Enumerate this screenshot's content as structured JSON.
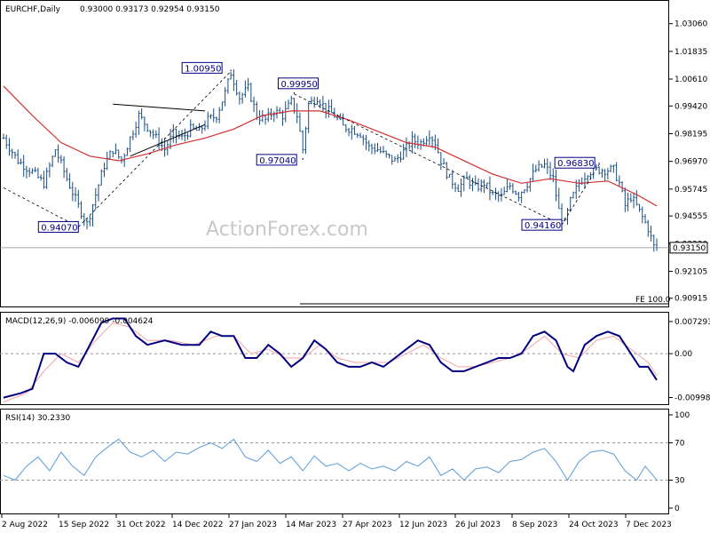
{
  "chart_data": {
    "type": "candlestick",
    "symbol": "EURCHF,Daily",
    "ohlc_text": "0.93000 0.93173 0.92954 0.93150",
    "watermark": "ActionForex.com",
    "x_ticks": [
      "2 Aug 2022",
      "15 Sep 2022",
      "31 Oct 2022",
      "14 Dec 2022",
      "27 Jan 2023",
      "14 Mar 2023",
      "27 Apr 2023",
      "12 Jun 2023",
      "26 Jul 2023",
      "8 Sep 2023",
      "24 Oct 2023",
      "7 Dec 2023"
    ],
    "price": {
      "y_ticks": [
        "1.03060",
        "1.01835",
        "1.00610",
        "0.99420",
        "0.98195",
        "0.96970",
        "0.95745",
        "0.94555",
        "0.93330",
        "0.92105",
        "0.90915"
      ],
      "ylim": [
        0.9055,
        1.0348
      ],
      "last_value": "0.93150",
      "fe_label": "FE 100.0",
      "close_path": [
        [
          0,
          0.98
        ],
        [
          5,
          0.97
        ],
        [
          10,
          0.965
        ],
        [
          14,
          0.96
        ],
        [
          18,
          0.975
        ],
        [
          22,
          0.962
        ],
        [
          26,
          0.95
        ],
        [
          29,
          0.942
        ],
        [
          32,
          0.955
        ],
        [
          35,
          0.968
        ],
        [
          38,
          0.975
        ],
        [
          41,
          0.97
        ],
        [
          44,
          0.98
        ],
        [
          47,
          0.99
        ],
        [
          50,
          0.985
        ],
        [
          53,
          0.98
        ],
        [
          56,
          0.975
        ],
        [
          59,
          0.982
        ],
        [
          62,
          0.98
        ],
        [
          65,
          0.984
        ],
        [
          68,
          0.983
        ],
        [
          71,
          0.988
        ],
        [
          74,
          0.99
        ],
        [
          77,
          1.0
        ],
        [
          79,
          1.009
        ],
        [
          82,
          0.998
        ],
        [
          85,
          1.002
        ],
        [
          88,
          0.99
        ],
        [
          91,
          0.988
        ],
        [
          94,
          0.992
        ],
        [
          97,
          0.99
        ],
        [
          100,
          0.996
        ],
        [
          102,
          0.99
        ],
        [
          104,
          0.975
        ],
        [
          106,
          0.995
        ],
        [
          109,
          0.998
        ],
        [
          112,
          0.993
        ],
        [
          115,
          0.99
        ],
        [
          118,
          0.985
        ],
        [
          121,
          0.984
        ],
        [
          124,
          0.982
        ],
        [
          127,
          0.976
        ],
        [
          130,
          0.975
        ],
        [
          133,
          0.972
        ],
        [
          136,
          0.97
        ],
        [
          139,
          0.974
        ],
        [
          142,
          0.979
        ],
        [
          145,
          0.978
        ],
        [
          148,
          0.982
        ],
        [
          150,
          0.978
        ],
        [
          152,
          0.97
        ],
        [
          155,
          0.962
        ],
        [
          158,
          0.958
        ],
        [
          161,
          0.962
        ],
        [
          164,
          0.958
        ],
        [
          167,
          0.96
        ],
        [
          170,
          0.955
        ],
        [
          173,
          0.954
        ],
        [
          176,
          0.959
        ],
        [
          179,
          0.955
        ],
        [
          182,
          0.96
        ],
        [
          185,
          0.966
        ],
        [
          188,
          0.968
        ],
        [
          191,
          0.962
        ],
        [
          193,
          0.948
        ],
        [
          195,
          0.942
        ],
        [
          197,
          0.952
        ],
        [
          200,
          0.96
        ],
        [
          203,
          0.965
        ],
        [
          206,
          0.966
        ],
        [
          209,
          0.966
        ],
        [
          212,
          0.966
        ],
        [
          214,
          0.96
        ],
        [
          216,
          0.95
        ],
        [
          218,
          0.954
        ],
        [
          220,
          0.95
        ],
        [
          222,
          0.945
        ],
        [
          224,
          0.94
        ],
        [
          226,
          0.932
        ],
        [
          227,
          0.9315
        ]
      ],
      "ma_path": [
        [
          0,
          1.003
        ],
        [
          10,
          0.99
        ],
        [
          20,
          0.978
        ],
        [
          30,
          0.972
        ],
        [
          40,
          0.97
        ],
        [
          50,
          0.973
        ],
        [
          60,
          0.977
        ],
        [
          70,
          0.98
        ],
        [
          80,
          0.984
        ],
        [
          90,
          0.99
        ],
        [
          100,
          0.992
        ],
        [
          110,
          0.992
        ],
        [
          120,
          0.988
        ],
        [
          130,
          0.983
        ],
        [
          140,
          0.978
        ],
        [
          150,
          0.976
        ],
        [
          160,
          0.97
        ],
        [
          170,
          0.964
        ],
        [
          180,
          0.96
        ],
        [
          190,
          0.962
        ],
        [
          200,
          0.96
        ],
        [
          210,
          0.961
        ],
        [
          220,
          0.955
        ],
        [
          227,
          0.95
        ]
      ],
      "annotations": [
        {
          "text": "1.00950",
          "x": 79,
          "y": 1.0095
        },
        {
          "text": "0.99950",
          "x": 101,
          "y": 0.9995
        },
        {
          "text": "0.97040",
          "x": 104,
          "y": 0.9704
        },
        {
          "text": "0.94070",
          "x": 26,
          "y": 0.9407
        },
        {
          "text": "0.96830",
          "x": 207,
          "y": 0.9683
        },
        {
          "text": "0.94160",
          "x": 194,
          "y": 0.9416
        }
      ]
    },
    "macd": {
      "label": "MACD(12,26,9) -0.006099 -0.004624",
      "y_ticks": [
        "0.007293",
        "0.00",
        "-0.009989"
      ],
      "ylim": [
        -0.0115,
        0.0085
      ],
      "main": [
        [
          0,
          -0.01
        ],
        [
          6,
          -0.009
        ],
        [
          10,
          -0.008
        ],
        [
          14,
          0.0
        ],
        [
          18,
          0.0
        ],
        [
          22,
          -0.002
        ],
        [
          26,
          -0.003
        ],
        [
          30,
          0.002
        ],
        [
          34,
          0.007
        ],
        [
          38,
          0.008
        ],
        [
          42,
          0.008
        ],
        [
          46,
          0.004
        ],
        [
          50,
          0.002
        ],
        [
          56,
          0.003
        ],
        [
          62,
          0.002
        ],
        [
          68,
          0.002
        ],
        [
          72,
          0.005
        ],
        [
          76,
          0.004
        ],
        [
          80,
          0.004
        ],
        [
          84,
          -0.001
        ],
        [
          88,
          -0.001
        ],
        [
          92,
          0.002
        ],
        [
          96,
          0.0
        ],
        [
          100,
          -0.003
        ],
        [
          104,
          -0.001
        ],
        [
          108,
          0.003
        ],
        [
          112,
          0.001
        ],
        [
          116,
          -0.002
        ],
        [
          120,
          -0.003
        ],
        [
          124,
          -0.003
        ],
        [
          128,
          -0.002
        ],
        [
          132,
          -0.003
        ],
        [
          136,
          -0.001
        ],
        [
          140,
          0.001
        ],
        [
          144,
          0.003
        ],
        [
          148,
          0.002
        ],
        [
          152,
          -0.002
        ],
        [
          156,
          -0.004
        ],
        [
          160,
          -0.004
        ],
        [
          164,
          -0.003
        ],
        [
          168,
          -0.002
        ],
        [
          172,
          -0.001
        ],
        [
          176,
          -0.001
        ],
        [
          180,
          0.0
        ],
        [
          184,
          0.004
        ],
        [
          188,
          0.005
        ],
        [
          192,
          0.003
        ],
        [
          196,
          -0.003
        ],
        [
          198,
          -0.004
        ],
        [
          202,
          0.002
        ],
        [
          206,
          0.004
        ],
        [
          210,
          0.005
        ],
        [
          214,
          0.004
        ],
        [
          218,
          0.0
        ],
        [
          221,
          -0.003
        ],
        [
          224,
          -0.003
        ],
        [
          227,
          -0.006
        ]
      ],
      "signal": [
        [
          0,
          -0.011
        ],
        [
          8,
          -0.009
        ],
        [
          14,
          -0.004
        ],
        [
          20,
          0.0
        ],
        [
          26,
          -0.002
        ],
        [
          32,
          0.003
        ],
        [
          38,
          0.007
        ],
        [
          44,
          0.006
        ],
        [
          50,
          0.003
        ],
        [
          58,
          0.003
        ],
        [
          66,
          0.002
        ],
        [
          74,
          0.004
        ],
        [
          80,
          0.004
        ],
        [
          86,
          0.0
        ],
        [
          92,
          0.001
        ],
        [
          98,
          -0.001
        ],
        [
          104,
          -0.001
        ],
        [
          110,
          0.002
        ],
        [
          116,
          -0.001
        ],
        [
          122,
          -0.002
        ],
        [
          128,
          -0.002
        ],
        [
          134,
          -0.002
        ],
        [
          140,
          0.0
        ],
        [
          146,
          0.002
        ],
        [
          152,
          -0.001
        ],
        [
          158,
          -0.003
        ],
        [
          164,
          -0.003
        ],
        [
          170,
          -0.002
        ],
        [
          176,
          -0.001
        ],
        [
          182,
          0.001
        ],
        [
          188,
          0.004
        ],
        [
          194,
          0.0
        ],
        [
          200,
          -0.001
        ],
        [
          206,
          0.003
        ],
        [
          212,
          0.004
        ],
        [
          218,
          0.001
        ],
        [
          224,
          -0.002
        ],
        [
          227,
          -0.005
        ]
      ]
    },
    "rsi": {
      "label": "RSI(14) 30.2330",
      "y_ticks": [
        "100",
        "70",
        "30",
        "0"
      ],
      "ylim": [
        0,
        100
      ],
      "levels": [
        70,
        30
      ],
      "path": [
        [
          0,
          35
        ],
        [
          4,
          30
        ],
        [
          8,
          45
        ],
        [
          12,
          55
        ],
        [
          16,
          40
        ],
        [
          20,
          60
        ],
        [
          24,
          45
        ],
        [
          28,
          35
        ],
        [
          32,
          55
        ],
        [
          36,
          65
        ],
        [
          40,
          74
        ],
        [
          44,
          60
        ],
        [
          48,
          55
        ],
        [
          52,
          62
        ],
        [
          56,
          50
        ],
        [
          60,
          60
        ],
        [
          64,
          58
        ],
        [
          68,
          65
        ],
        [
          72,
          70
        ],
        [
          76,
          64
        ],
        [
          80,
          74
        ],
        [
          84,
          55
        ],
        [
          88,
          50
        ],
        [
          92,
          62
        ],
        [
          96,
          48
        ],
        [
          100,
          55
        ],
        [
          104,
          40
        ],
        [
          108,
          56
        ],
        [
          112,
          45
        ],
        [
          116,
          48
        ],
        [
          120,
          40
        ],
        [
          124,
          48
        ],
        [
          128,
          42
        ],
        [
          132,
          45
        ],
        [
          136,
          40
        ],
        [
          140,
          50
        ],
        [
          144,
          45
        ],
        [
          148,
          55
        ],
        [
          152,
          35
        ],
        [
          156,
          42
        ],
        [
          160,
          30
        ],
        [
          164,
          42
        ],
        [
          168,
          44
        ],
        [
          172,
          38
        ],
        [
          176,
          50
        ],
        [
          180,
          52
        ],
        [
          184,
          60
        ],
        [
          188,
          64
        ],
        [
          192,
          50
        ],
        [
          196,
          30
        ],
        [
          200,
          50
        ],
        [
          204,
          60
        ],
        [
          208,
          62
        ],
        [
          212,
          58
        ],
        [
          216,
          40
        ],
        [
          220,
          30
        ],
        [
          223,
          45
        ],
        [
          226,
          34
        ],
        [
          227,
          30
        ]
      ]
    }
  }
}
